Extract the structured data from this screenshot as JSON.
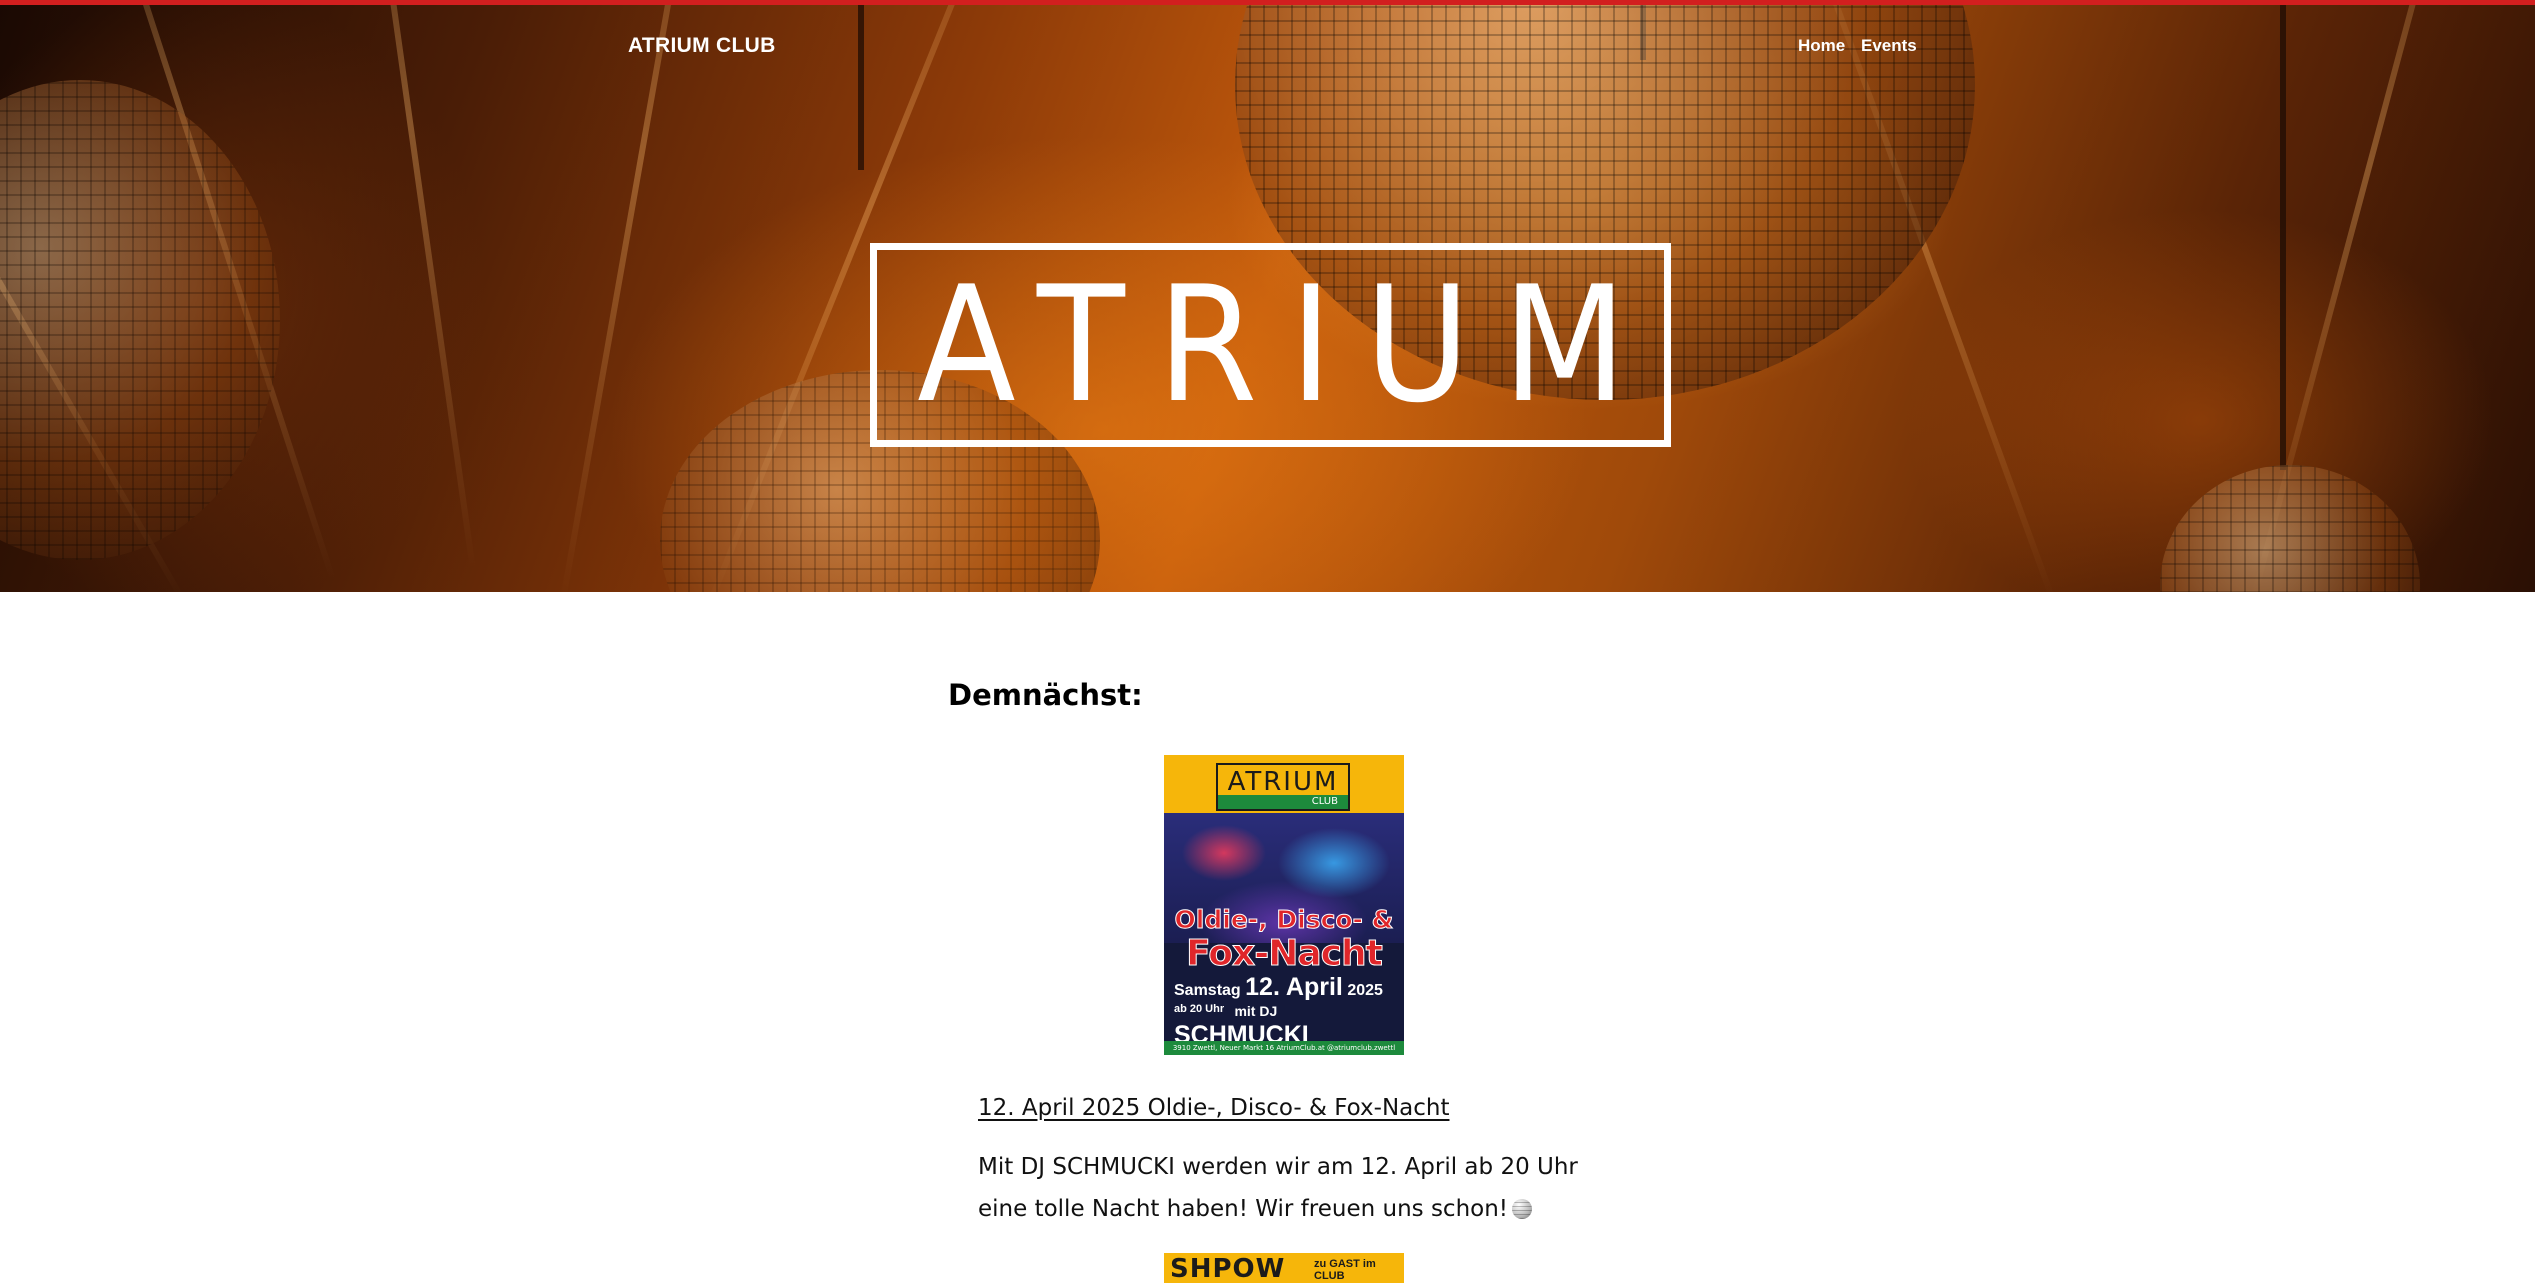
{
  "header": {
    "brand": "ATRIUM CLUB",
    "nav": [
      {
        "label": "Home"
      },
      {
        "label": "Events"
      }
    ]
  },
  "hero": {
    "logo_text": "ATRIUM"
  },
  "main": {
    "heading": "Demnächst:",
    "events": [
      {
        "poster": {
          "logo_word": "ATRIUM",
          "logo_sub": "CLUB",
          "title_line1": "Oldie-, Disco- &",
          "title_line2": "Fox-Nacht",
          "day": "Samstag",
          "date": "12. April",
          "year": "2025",
          "time": "ab 20 Uhr",
          "dj_prefix": "mit DJ",
          "dj_name": "SCHMUCKI",
          "footer": "3910 Zwettl, Neuer Markt 16   AtriumClub.at   @atriumclub.zwettl"
        },
        "link": "12. April 2025 Oldie-, Disco- & Fox-Nacht",
        "description": "Mit DJ SCHMUCKI werden wir am 12. April ab 20 Uhr eine tolle Nacht haben! Wir freuen uns schon!"
      },
      {
        "poster": {
          "word": "SHPOW",
          "small": "zu GAST im CLUB"
        }
      }
    ]
  },
  "colors": {
    "accent_line": "#d21f1f",
    "poster_yellow": "#f6b60a",
    "poster_green": "#1d8a3c",
    "poster_red": "#e0262a"
  },
  "icons": {
    "disco_ball": "mirror-ball-icon"
  }
}
